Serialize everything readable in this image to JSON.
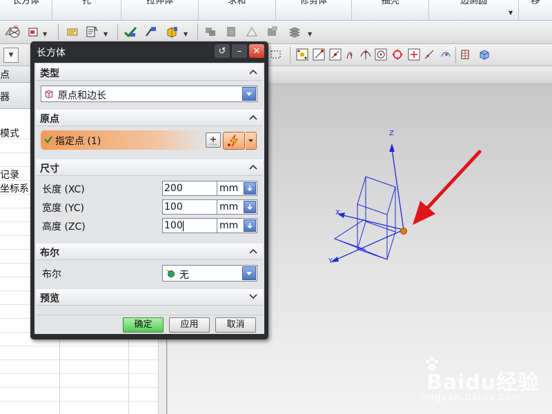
{
  "menu_tabs": [
    {
      "label": "长方体"
    },
    {
      "label": "孔"
    },
    {
      "label": "拉伸体"
    },
    {
      "label": "求和"
    },
    {
      "label": "修剪体"
    },
    {
      "label": "抽壳"
    },
    {
      "label": "边倒圆"
    },
    {
      "label": "移"
    }
  ],
  "navigator": {
    "header1": "点",
    "header2": "器",
    "rows": [
      "模式",
      "记录",
      "坐标系"
    ]
  },
  "dialog": {
    "title": "长方体",
    "sections": {
      "type": {
        "title": "类型",
        "value": "原点和边长"
      },
      "origin": {
        "title": "原点",
        "specify_point": "指定点 (1)"
      },
      "dimensions": {
        "title": "尺寸",
        "fields": [
          {
            "label": "长度 (XC)",
            "value": "200",
            "unit": "mm"
          },
          {
            "label": "宽度 (YC)",
            "value": "100",
            "unit": "mm"
          },
          {
            "label": "高度 (ZC)",
            "value": "100",
            "unit": "mm"
          }
        ]
      },
      "boolean": {
        "title": "布尔",
        "label": "布尔",
        "value": "无"
      },
      "preview": {
        "title": "预览"
      }
    },
    "buttons": {
      "ok": "确定",
      "apply": "应用",
      "cancel": "取消"
    }
  },
  "viewport": {
    "axis_labels": {
      "z": "Z",
      "x": "X",
      "y": "Y"
    }
  },
  "watermark": {
    "text": "Baidu经验",
    "url": "jingyan.baidu.com"
  },
  "colors": {
    "accent_blue": "#4f76c2",
    "point_orange": "#e27b1c",
    "arrow_red": "#e0141a",
    "ok_green": "#58c95b"
  }
}
